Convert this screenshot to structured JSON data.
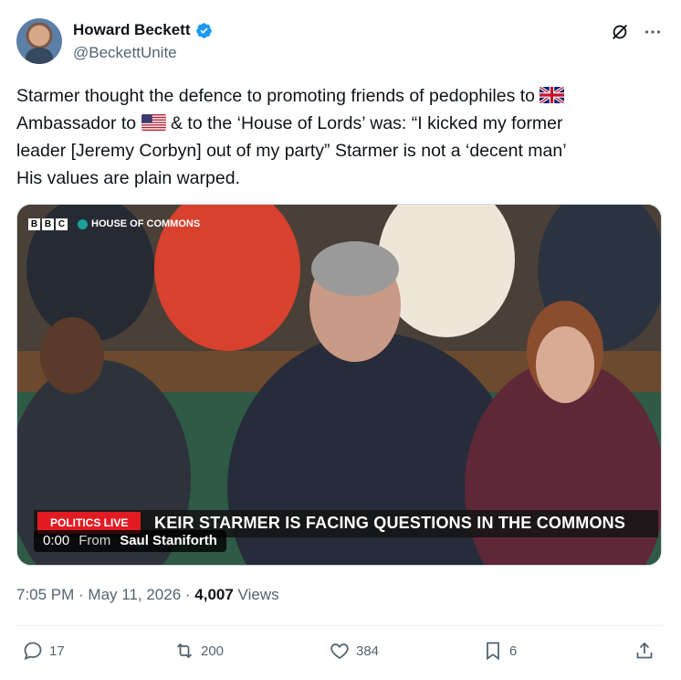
{
  "author": {
    "display_name": "Howard Beckett",
    "handle": "@BeckettUnite"
  },
  "header_icons": [
    "grok-icon",
    "more-icon"
  ],
  "tweet": {
    "line1": "Starmer thought the defence to promoting friends of pedophiles to",
    "line2a": "Ambassador to",
    "line2b": "& to the ‘House of Lords’ was: “I kicked my former",
    "line3": "leader [Jeremy Corbyn] out of my party” Starmer is not a ‘decent man’",
    "line4": "His values are plain warped."
  },
  "video": {
    "channel_logo": "BBC",
    "channel_name": "HOUSE OF COMMONS",
    "tag": "POLITICS LIVE",
    "headline": "KEIR STARMER IS FACING QUESTIONS IN THE COMMONS",
    "timestamp": "0:00",
    "from_label": "From",
    "source": "Saul Staniforth"
  },
  "meta": {
    "datetime": "7:05 PM · May 11, 2026 · ",
    "views_count": "4,007",
    "views_label": " Views"
  },
  "actions": {
    "replies": "17",
    "reposts": "200",
    "likes": "384",
    "bookmarks": "6"
  },
  "colors": {
    "verified": "#1d9bf0",
    "text": "#0f1419",
    "secondary": "#536471",
    "politics_live": "#e21b23"
  }
}
